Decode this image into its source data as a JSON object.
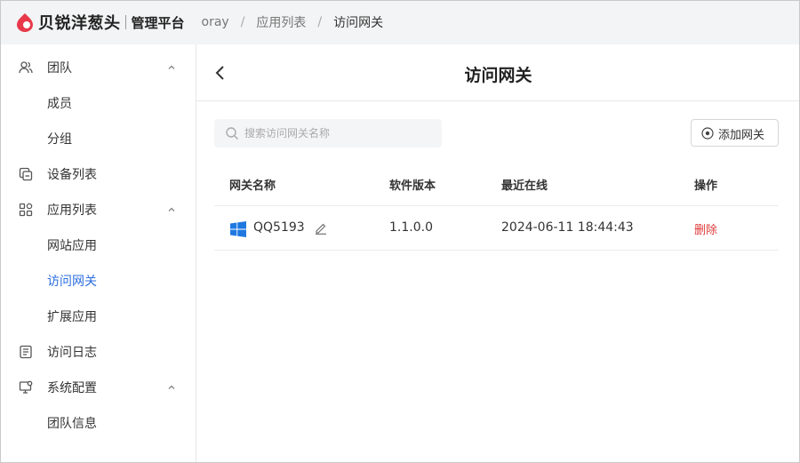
{
  "header": {
    "brand": "贝锐洋葱头",
    "platform": "管理平台",
    "breadcrumbs": [
      "oray",
      "应用列表",
      "访问网关"
    ],
    "colors": {
      "brand": "#e8394a",
      "accent": "#2a6de0",
      "danger": "#e03a3a"
    }
  },
  "sidebar": {
    "items": [
      {
        "label": "团队",
        "icon": "team-icon",
        "expanded": true
      },
      {
        "label": "成员"
      },
      {
        "label": "分组"
      },
      {
        "label": "设备列表",
        "icon": "device-icon"
      },
      {
        "label": "应用列表",
        "icon": "apps-icon",
        "expanded": true
      },
      {
        "label": "网站应用"
      },
      {
        "label": "访问网关",
        "active": true
      },
      {
        "label": "扩展应用"
      },
      {
        "label": "访问日志",
        "icon": "log-icon"
      },
      {
        "label": "系统配置",
        "icon": "settings-monitor-icon",
        "expanded": true
      },
      {
        "label": "团队信息"
      }
    ]
  },
  "main": {
    "title": "访问网关",
    "search": {
      "placeholder": "搜索访问网关名称",
      "value": ""
    },
    "add_button": "添加网关",
    "table": {
      "columns": [
        "网关名称",
        "软件版本",
        "最近在线",
        "操作"
      ],
      "rows": [
        {
          "name": "QQ5193",
          "os_icon": "windows-icon",
          "version": "1.1.0.0",
          "last_online": "2024-06-11 18:44:43",
          "action": "删除"
        }
      ]
    }
  }
}
